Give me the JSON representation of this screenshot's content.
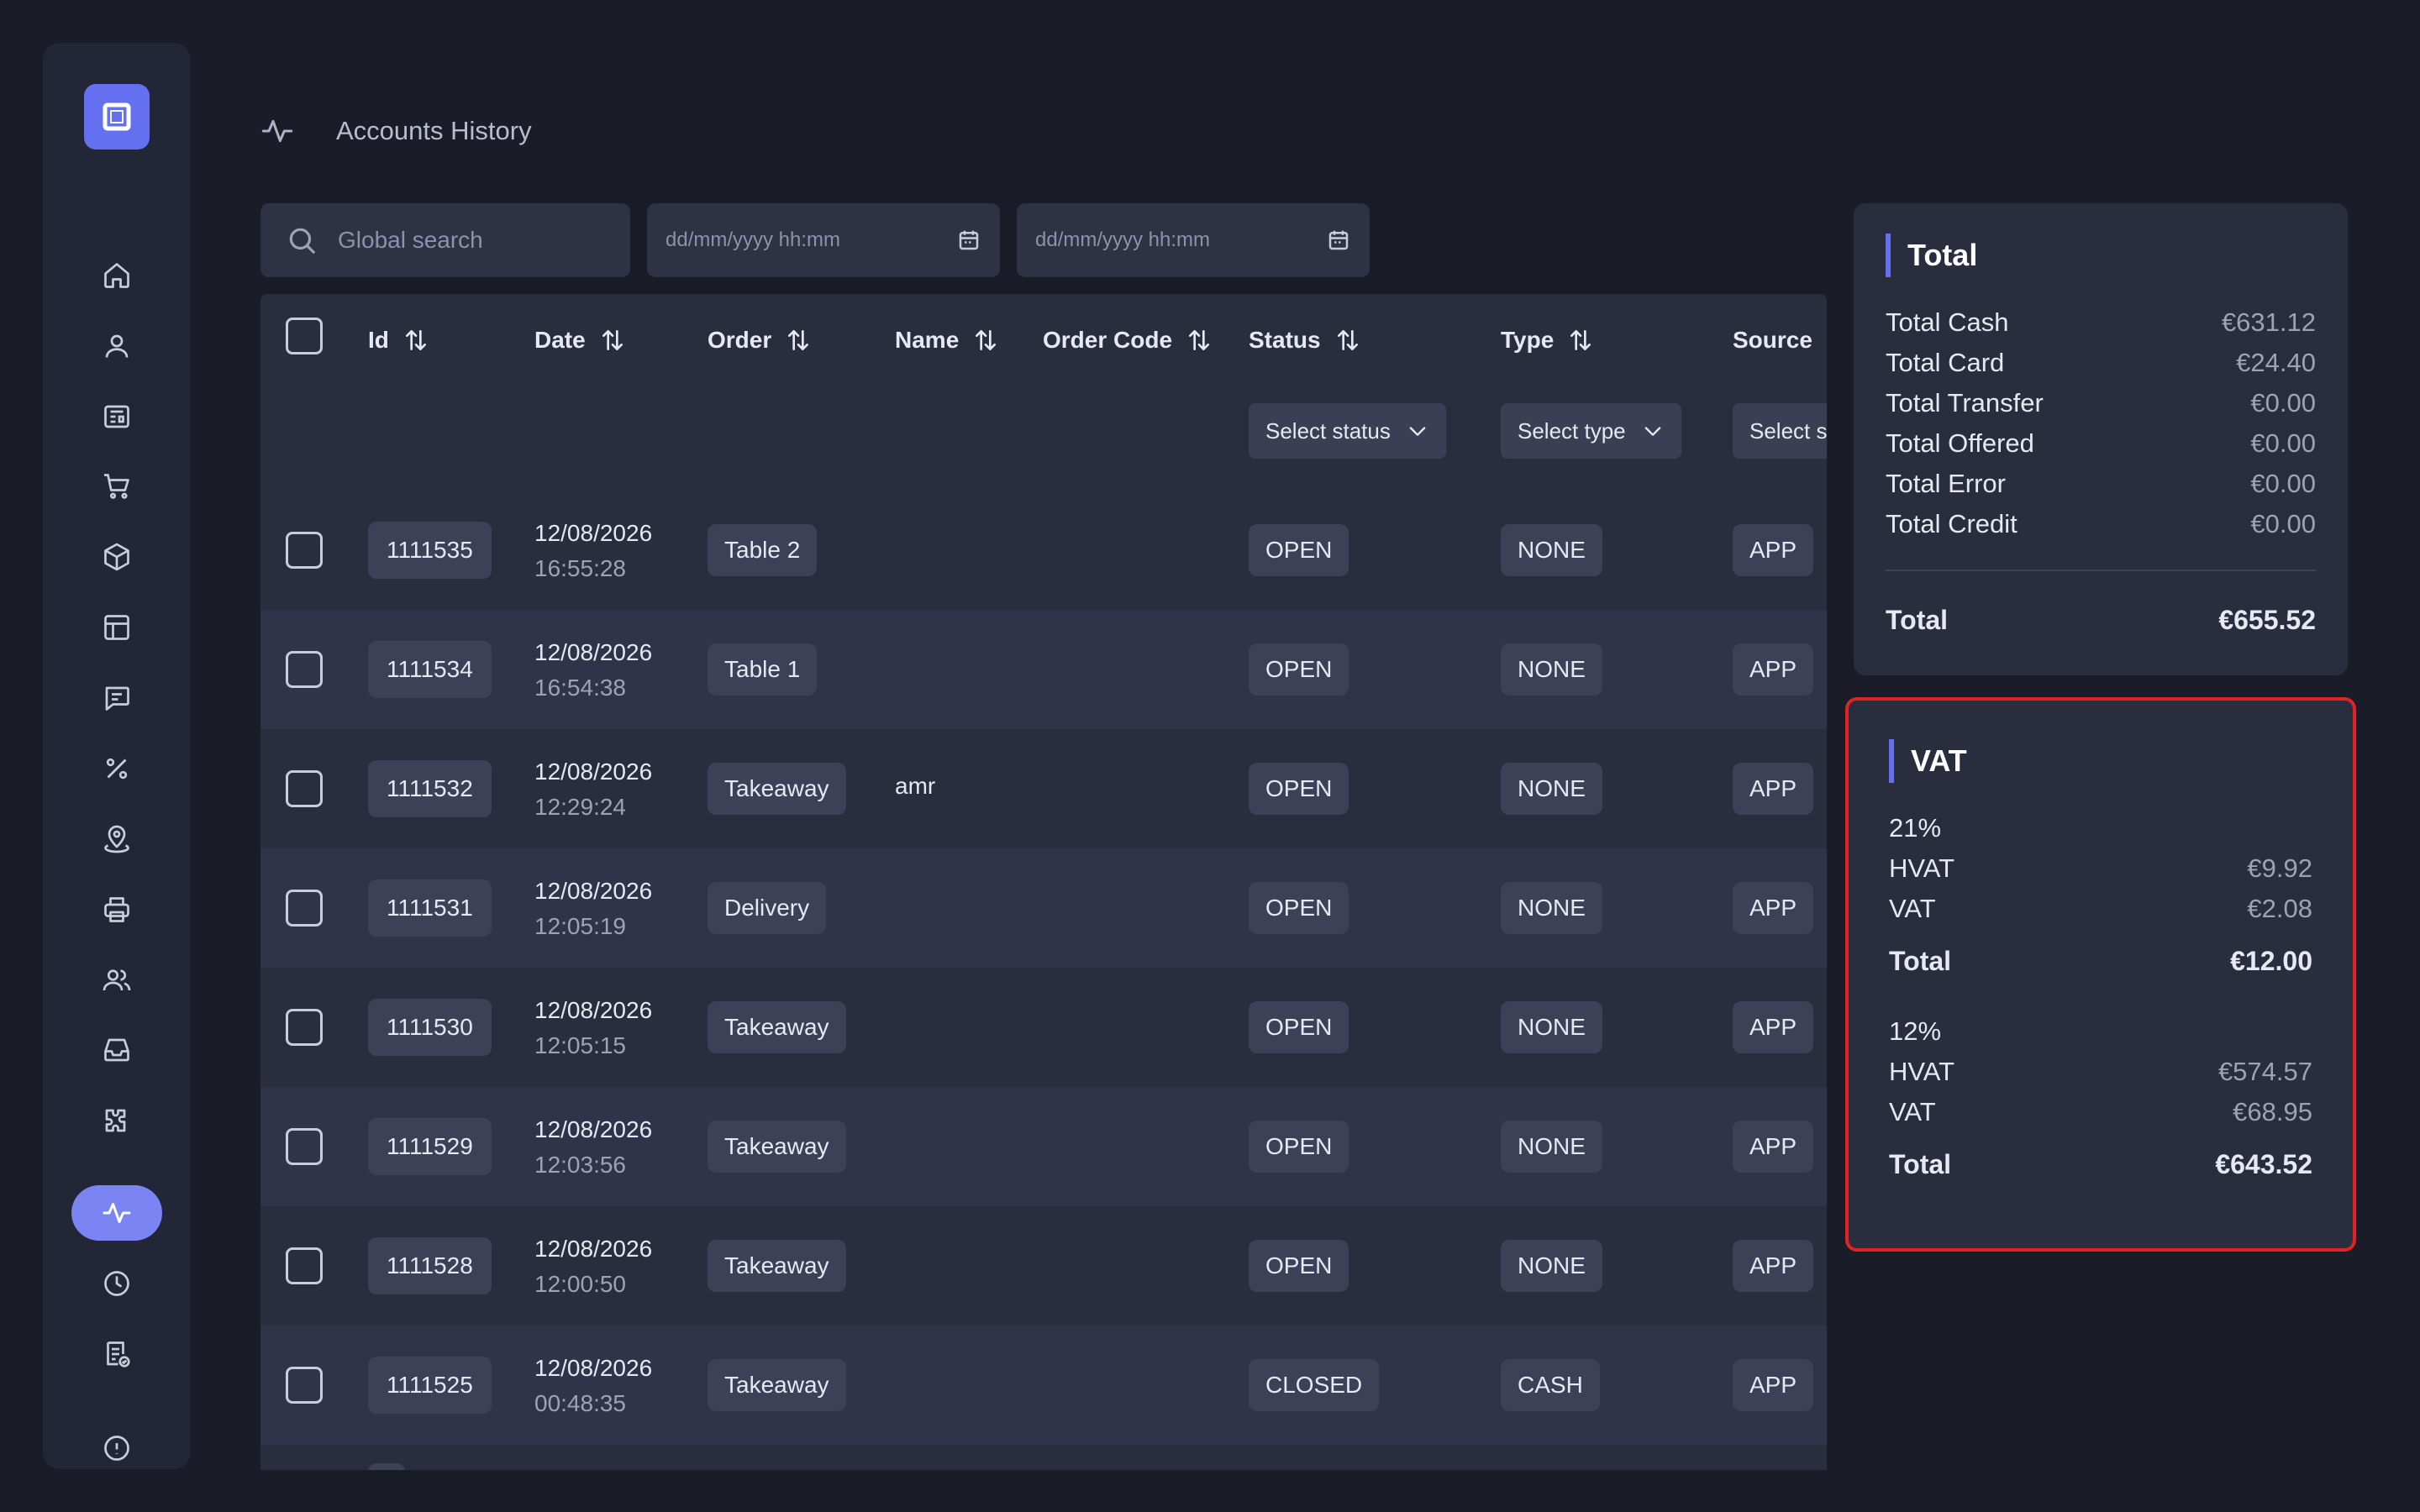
{
  "header": {
    "title": "Accounts History"
  },
  "filters": {
    "search_placeholder": "Global search",
    "date_from_placeholder": "dd/mm/yyyy hh:mm",
    "date_to_placeholder": "dd/mm/yyyy hh:mm"
  },
  "table": {
    "columns": {
      "id": "Id",
      "date": "Date",
      "order": "Order",
      "name": "Name",
      "order_code": "Order Code",
      "status": "Status",
      "type": "Type",
      "source": "Source"
    },
    "dropdowns": {
      "status": "Select status",
      "type": "Select type",
      "source": "Select s"
    },
    "rows": [
      {
        "id": "1111535",
        "date": "12/08/2026",
        "time": "16:55:28",
        "order": "Table 2",
        "name": "",
        "status": "OPEN",
        "type": "NONE",
        "source": "APP"
      },
      {
        "id": "1111534",
        "date": "12/08/2026",
        "time": "16:54:38",
        "order": "Table 1",
        "name": "",
        "status": "OPEN",
        "type": "NONE",
        "source": "APP"
      },
      {
        "id": "1111532",
        "date": "12/08/2026",
        "time": "12:29:24",
        "order": "Takeaway",
        "name": "amr",
        "status": "OPEN",
        "type": "NONE",
        "source": "APP"
      },
      {
        "id": "1111531",
        "date": "12/08/2026",
        "time": "12:05:19",
        "order": "Delivery",
        "name": "",
        "status": "OPEN",
        "type": "NONE",
        "source": "APP"
      },
      {
        "id": "1111530",
        "date": "12/08/2026",
        "time": "12:05:15",
        "order": "Takeaway",
        "name": "",
        "status": "OPEN",
        "type": "NONE",
        "source": "APP"
      },
      {
        "id": "1111529",
        "date": "12/08/2026",
        "time": "12:03:56",
        "order": "Takeaway",
        "name": "",
        "status": "OPEN",
        "type": "NONE",
        "source": "APP"
      },
      {
        "id": "1111528",
        "date": "12/08/2026",
        "time": "12:00:50",
        "order": "Takeaway",
        "name": "",
        "status": "OPEN",
        "type": "NONE",
        "source": "APP"
      },
      {
        "id": "1111525",
        "date": "12/08/2026",
        "time": "00:48:35",
        "order": "Takeaway",
        "name": "",
        "status": "CLOSED",
        "type": "CASH",
        "source": "APP"
      }
    ]
  },
  "total_card": {
    "title": "Total",
    "lines": [
      {
        "label": "Total Cash",
        "value": "€631.12"
      },
      {
        "label": "Total Card",
        "value": "€24.40"
      },
      {
        "label": "Total Transfer",
        "value": "€0.00"
      },
      {
        "label": "Total Offered",
        "value": "€0.00"
      },
      {
        "label": "Total Error",
        "value": "€0.00"
      },
      {
        "label": "Total Credit",
        "value": "€0.00"
      }
    ],
    "total_label": "Total",
    "total_value": "€655.52"
  },
  "vat_card": {
    "title": "VAT",
    "groups": [
      {
        "rate": "21%",
        "hvat_label": "HVAT",
        "hvat": "€9.92",
        "vat_label": "VAT",
        "vat": "€2.08",
        "total_label": "Total",
        "total": "€12.00"
      },
      {
        "rate": "12%",
        "hvat_label": "HVAT",
        "hvat": "€574.57",
        "vat_label": "VAT",
        "vat": "€68.95",
        "total_label": "Total",
        "total": "€643.52"
      }
    ]
  },
  "sidebar": {
    "items": [
      "home-icon",
      "user-icon",
      "newspaper-icon",
      "cart-icon",
      "box-icon",
      "table-icon",
      "chat-icon",
      "percent-icon",
      "location-icon",
      "printer-icon",
      "users-icon",
      "inbox-icon",
      "puzzle-icon",
      "activity-icon",
      "clock-icon",
      "receipt-check-icon"
    ],
    "active": "activity-icon"
  },
  "colors": {
    "accent": "#6470f0",
    "active_nav": "#7a84f3",
    "highlight": "#e02424",
    "background": "#1a1c27",
    "panel": "#2a2d3e"
  }
}
